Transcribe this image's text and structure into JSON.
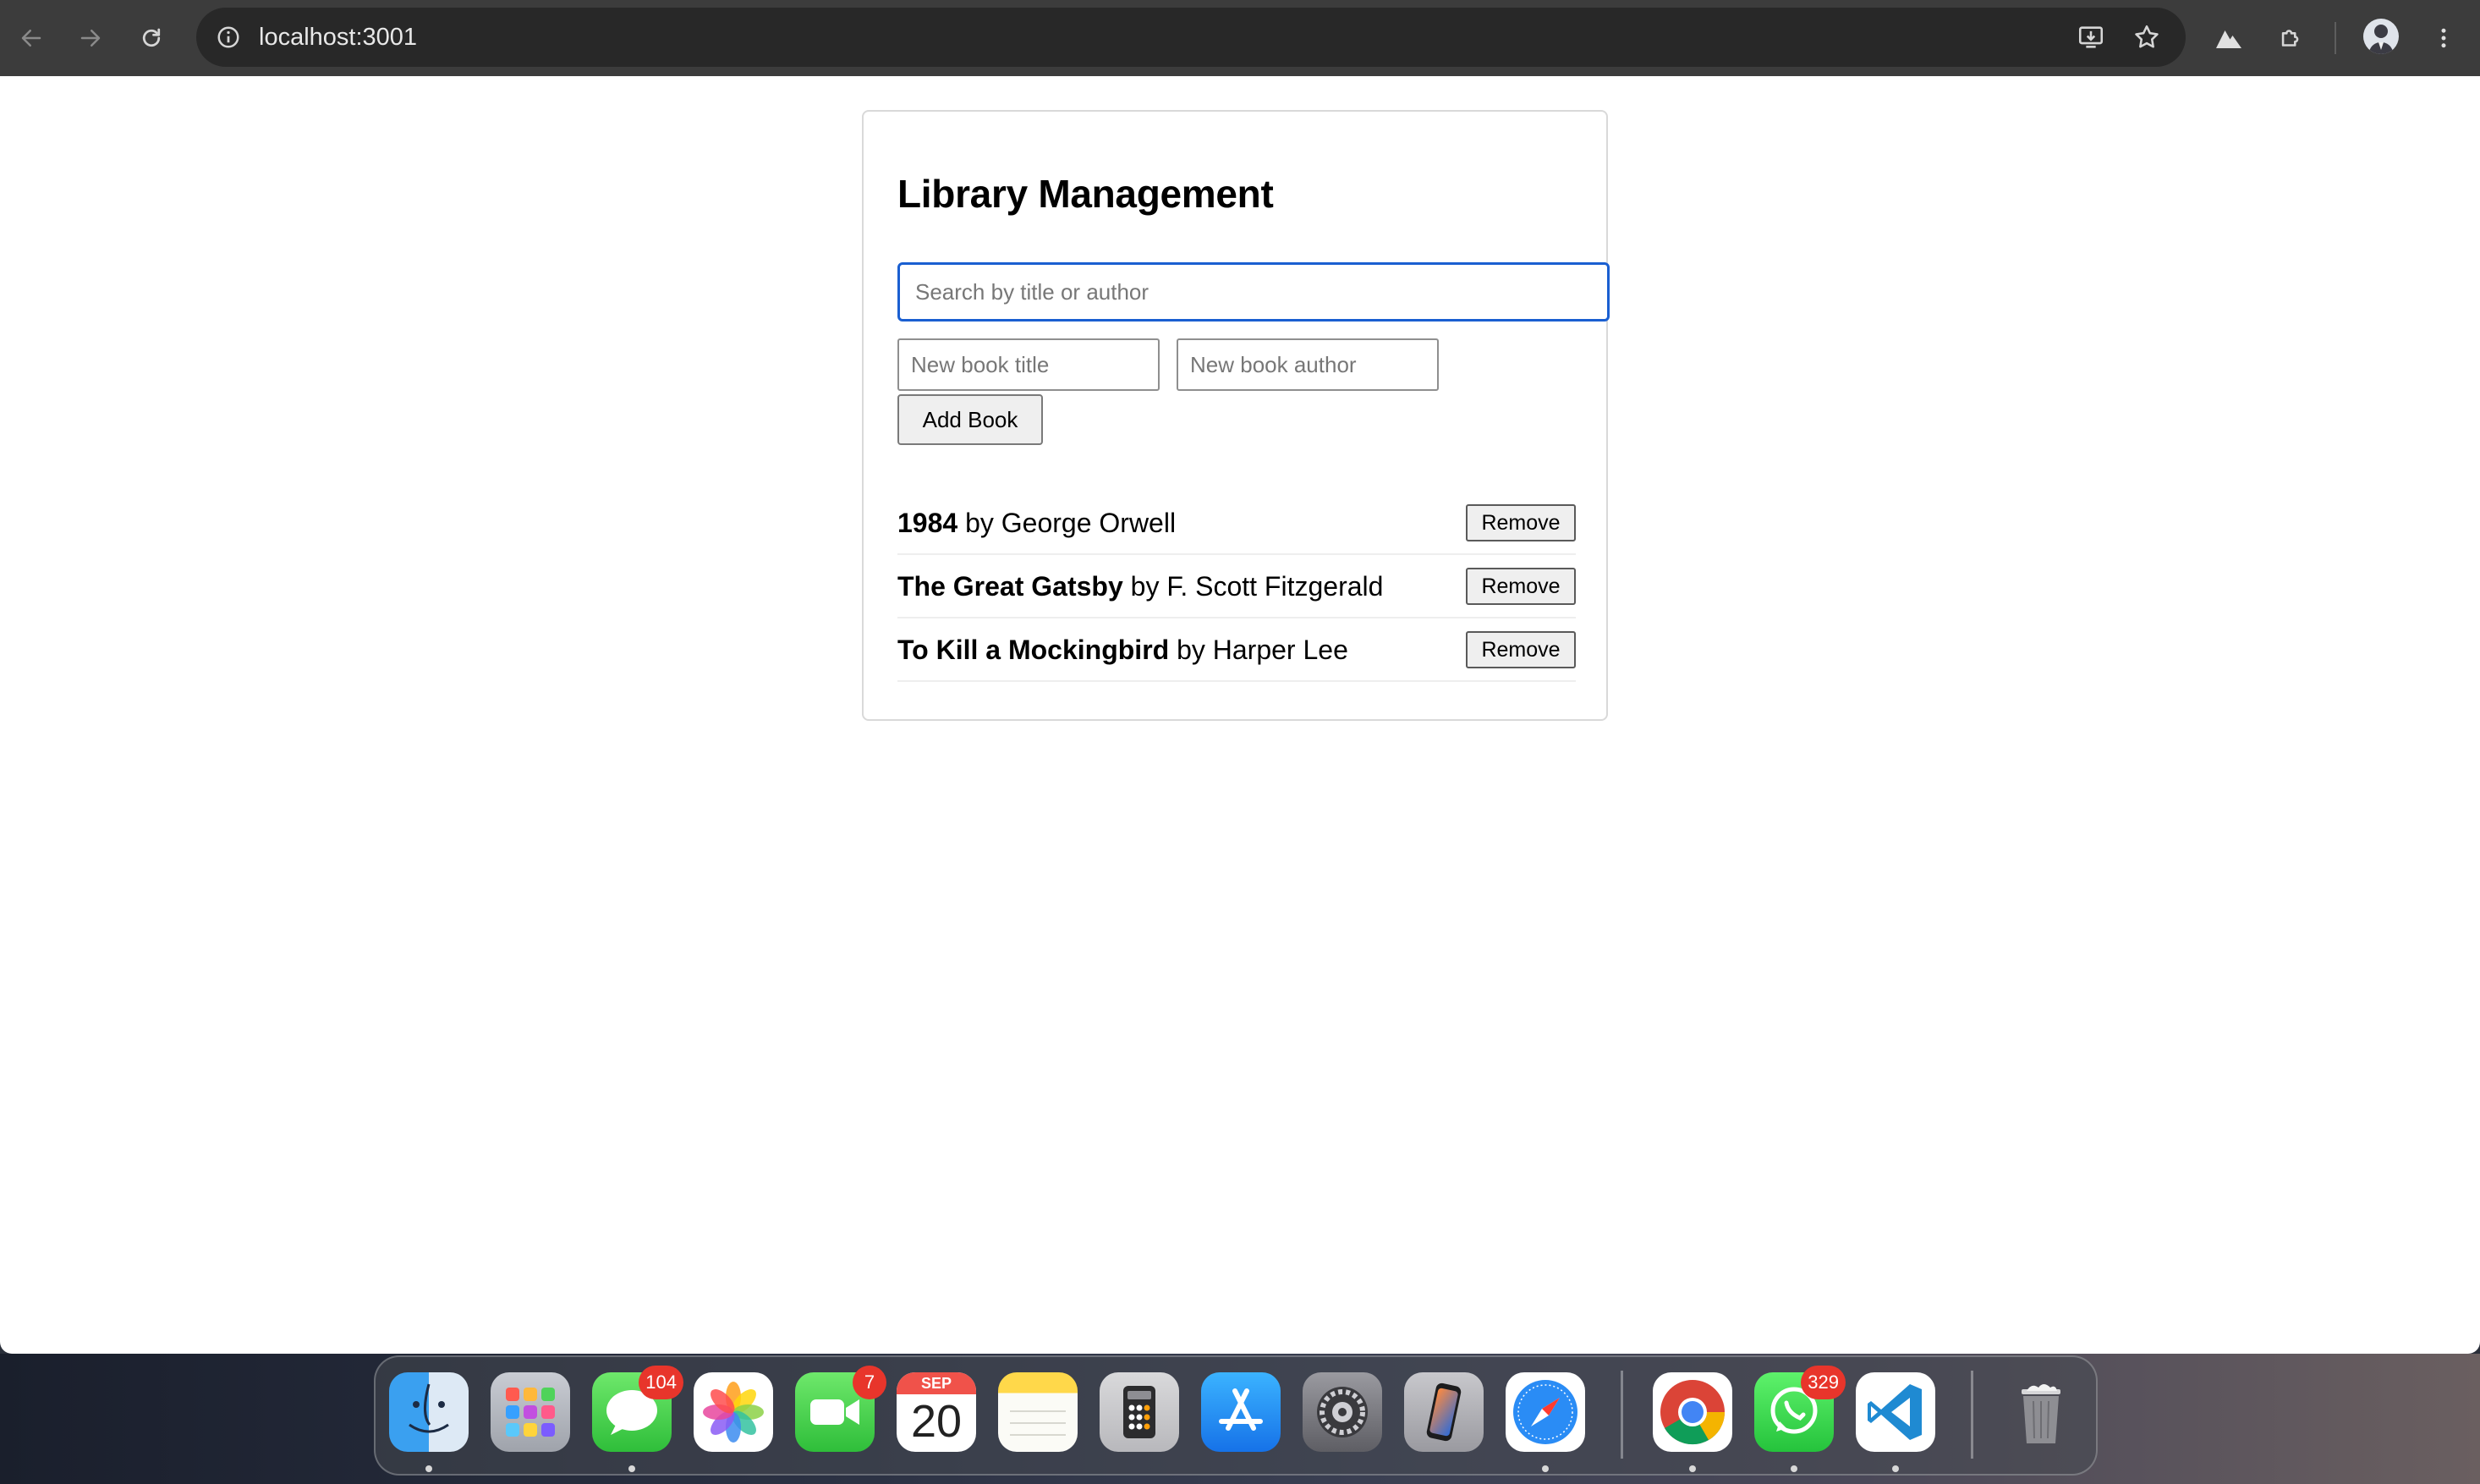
{
  "browser": {
    "url": "localhost:3001"
  },
  "page": {
    "title": "Library Management",
    "search": {
      "placeholder": "Search by title or author",
      "value": ""
    },
    "new_title": {
      "placeholder": "New book title",
      "value": ""
    },
    "new_author": {
      "placeholder": "New book author",
      "value": ""
    },
    "add_button": "Add Book",
    "books": [
      {
        "title": "1984",
        "by": "by",
        "author": "George Orwell",
        "remove": "Remove"
      },
      {
        "title": "The Great Gatsby",
        "by": "by",
        "author": "F. Scott Fitzgerald",
        "remove": "Remove"
      },
      {
        "title": "To Kill a Mockingbird",
        "by": "by",
        "author": "Harper Lee",
        "remove": "Remove"
      }
    ]
  },
  "dock": {
    "apps": [
      {
        "name": "Finder",
        "icon": "finder-icon"
      },
      {
        "name": "Launchpad",
        "icon": "launchpad-icon"
      },
      {
        "name": "Messages",
        "icon": "messages-icon",
        "badge": "104"
      },
      {
        "name": "Photos",
        "icon": "photos-icon"
      },
      {
        "name": "FaceTime",
        "icon": "facetime-icon",
        "badge": "7"
      },
      {
        "name": "Calendar",
        "icon": "calendar-icon",
        "month": "SEP",
        "day": "20"
      },
      {
        "name": "Notes",
        "icon": "notes-icon"
      },
      {
        "name": "Calculator",
        "icon": "calculator-icon"
      },
      {
        "name": "App Store",
        "icon": "app-store-icon"
      },
      {
        "name": "System Settings",
        "icon": "settings-icon"
      },
      {
        "name": "iPhone Mirroring",
        "icon": "iphone-icon"
      },
      {
        "name": "Safari",
        "icon": "safari-icon"
      },
      {
        "name": "Chrome",
        "icon": "chrome-icon"
      },
      {
        "name": "WhatsApp",
        "icon": "whatsapp-icon",
        "badge": "329"
      },
      {
        "name": "VS Code",
        "icon": "vscode-icon"
      },
      {
        "name": "Trash",
        "icon": "trash-icon"
      }
    ]
  },
  "colors": {
    "accent": "#1a5fd1",
    "chrome_bg": "#3c3c3c",
    "badge": "#e8352b"
  }
}
